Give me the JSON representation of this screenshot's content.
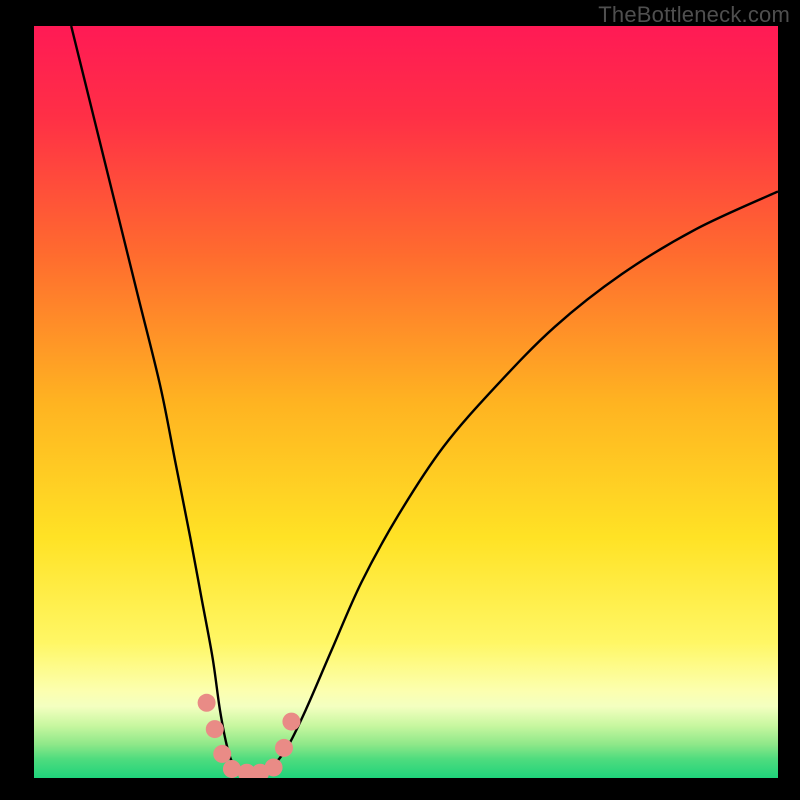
{
  "watermark": "TheBottleneck.com",
  "chart_data": {
    "type": "line",
    "title": "",
    "xlabel": "",
    "ylabel": "",
    "xlim": [
      0,
      100
    ],
    "ylim": [
      0,
      100
    ],
    "grid": false,
    "legend": false,
    "background": {
      "type": "vertical-gradient",
      "stops": [
        {
          "t": 0.0,
          "color": "#ff1a55"
        },
        {
          "t": 0.12,
          "color": "#ff2f46"
        },
        {
          "t": 0.3,
          "color": "#ff6a2f"
        },
        {
          "t": 0.5,
          "color": "#ffb321"
        },
        {
          "t": 0.68,
          "color": "#ffe225"
        },
        {
          "t": 0.82,
          "color": "#fff765"
        },
        {
          "t": 0.885,
          "color": "#fcffb0"
        },
        {
          "t": 0.905,
          "color": "#f3ffc0"
        },
        {
          "t": 0.93,
          "color": "#c8f7a0"
        },
        {
          "t": 0.955,
          "color": "#8fe889"
        },
        {
          "t": 0.975,
          "color": "#4edc7e"
        },
        {
          "t": 1.0,
          "color": "#1fd37b"
        }
      ]
    },
    "series": [
      {
        "name": "bottleneck-curve",
        "color": "#000000",
        "x": [
          5,
          8,
          11,
          14,
          17,
          19,
          21,
          22.5,
          24,
          25,
          26,
          27,
          28.7,
          30.5,
          32,
          34,
          36.5,
          40,
          44,
          49,
          55,
          62,
          70,
          79,
          89,
          100
        ],
        "y": [
          100,
          88,
          76,
          64,
          52,
          42,
          32,
          24,
          16,
          9,
          4,
          1.5,
          0.5,
          0.5,
          1.5,
          4,
          9,
          17,
          26,
          35,
          44,
          52,
          60,
          67,
          73,
          78
        ]
      }
    ],
    "markers": {
      "name": "highlight-dots",
      "color": "#e98b86",
      "radius_px": 9,
      "points": [
        {
          "x": 23.2,
          "y": 10.0
        },
        {
          "x": 24.3,
          "y": 6.5
        },
        {
          "x": 25.3,
          "y": 3.2
        },
        {
          "x": 26.6,
          "y": 1.2
        },
        {
          "x": 28.6,
          "y": 0.7
        },
        {
          "x": 30.4,
          "y": 0.7
        },
        {
          "x": 32.2,
          "y": 1.4
        },
        {
          "x": 33.6,
          "y": 4.0
        },
        {
          "x": 34.6,
          "y": 7.5
        }
      ]
    }
  }
}
